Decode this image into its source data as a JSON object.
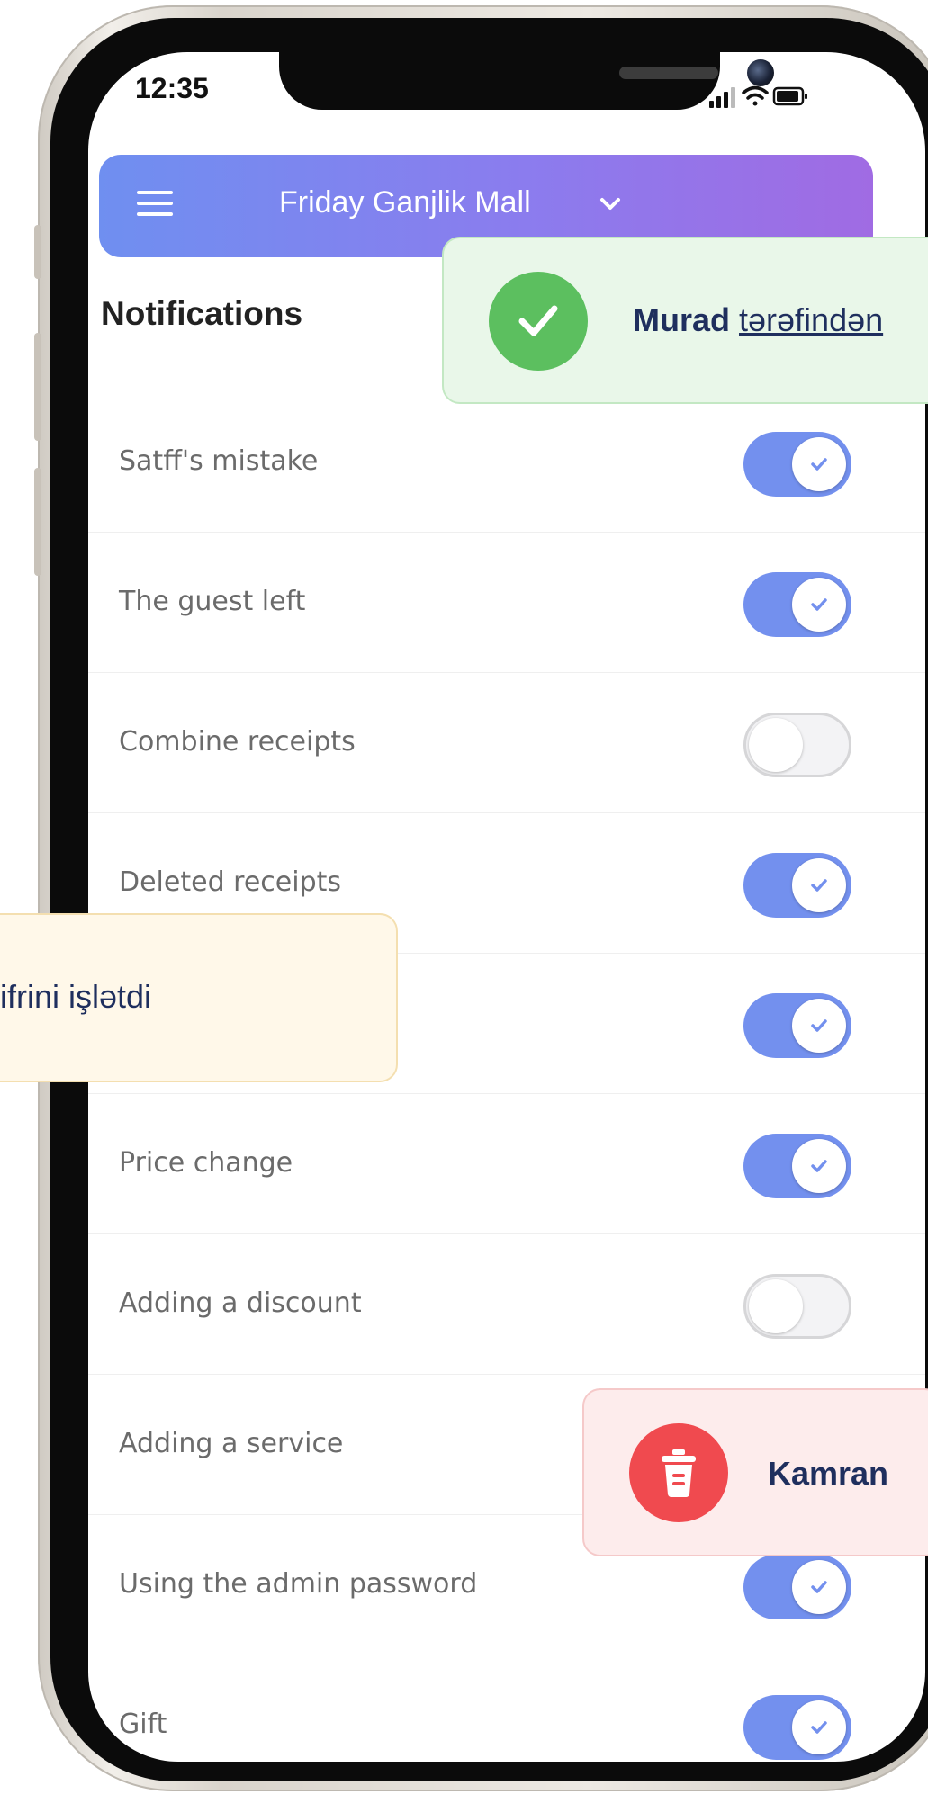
{
  "status_bar": {
    "time": "12:35"
  },
  "header": {
    "title": "Friday Ganjlik Mall"
  },
  "section_title": "Notifications",
  "settings": [
    {
      "label": "Satff's mistake",
      "enabled": true
    },
    {
      "label": "The guest left",
      "enabled": true
    },
    {
      "label": "Combine receipts",
      "enabled": false
    },
    {
      "label": "Deleted receipts",
      "enabled": true
    },
    {
      "label": "",
      "enabled": true
    },
    {
      "label": "Price change",
      "enabled": true
    },
    {
      "label": "Adding a discount",
      "enabled": false
    },
    {
      "label": "Adding a service",
      "enabled": false
    },
    {
      "label": "Using the admin password",
      "enabled": true
    },
    {
      "label": "Gift",
      "enabled": true
    }
  ],
  "toasts": {
    "success": {
      "name": "Murad",
      "text": "tərəfindən"
    },
    "warning": {
      "text": "şifrini işlətdi"
    },
    "delete": {
      "name": "Kamran"
    }
  },
  "colors": {
    "accent": "#7390ee",
    "header_start": "#6f8ff0",
    "header_end": "#a06be3",
    "success": "#5cbf5f",
    "danger": "#f04a4f"
  },
  "icons": {
    "menu": "hamburger-icon",
    "header_dropdown": "chevron-down-icon",
    "success": "checkmark-icon",
    "delete": "trash-icon"
  }
}
